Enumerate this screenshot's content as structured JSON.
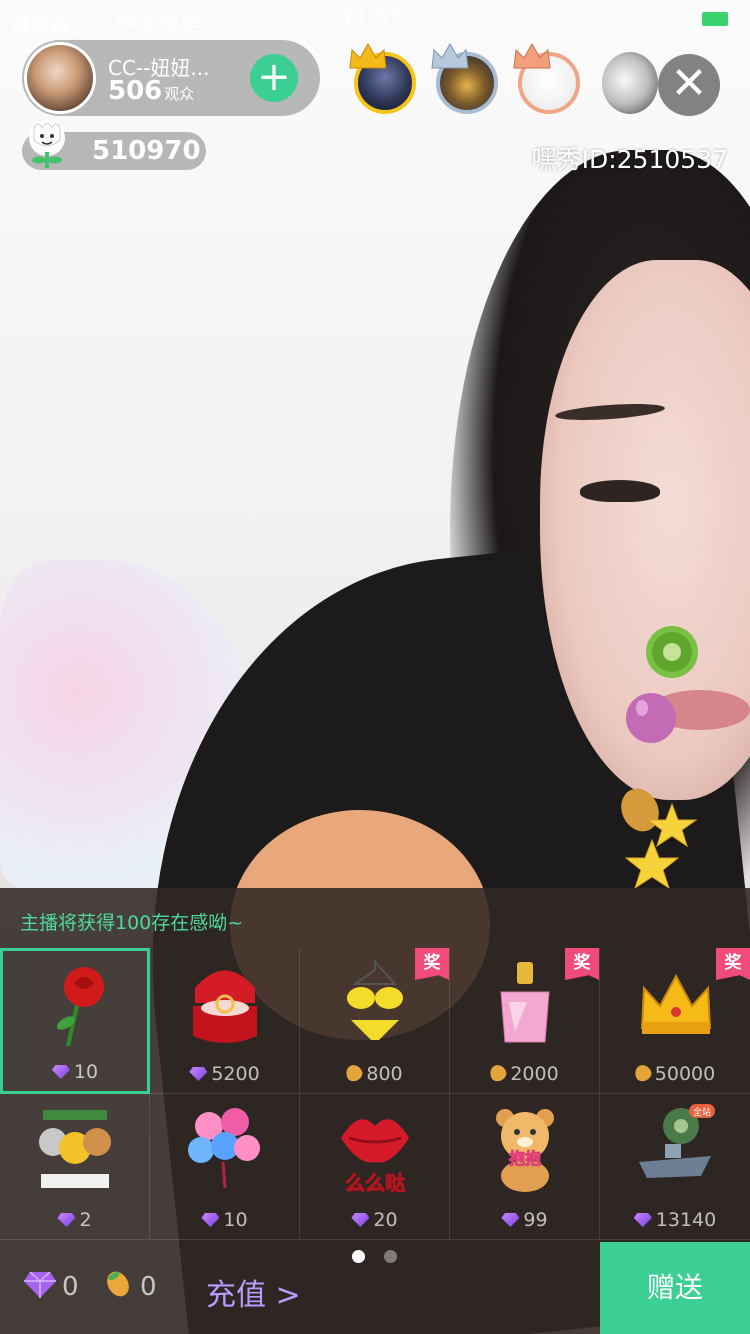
{
  "status_bar": {
    "carrier": "●●●○○ 中国电信 ⌔",
    "time": "11:53"
  },
  "host": {
    "name": "CC--妞妞...",
    "viewer_count": "506",
    "viewer_label": "观众"
  },
  "flower_score": "510970",
  "room_id": "嘿秀ID:2510537",
  "panel": {
    "hint": "主播将获得100存在感呦~",
    "award_tag": "奖",
    "gifts": [
      {
        "name": "rose",
        "price": "10",
        "currency": "diamond",
        "award": false,
        "selected": true
      },
      {
        "name": "ring-box",
        "price": "5200",
        "currency": "diamond",
        "award": false,
        "selected": false
      },
      {
        "name": "bikini",
        "price": "800",
        "currency": "bean",
        "award": true,
        "selected": false
      },
      {
        "name": "perfume",
        "price": "2000",
        "currency": "bean",
        "award": true,
        "selected": false
      },
      {
        "name": "crown",
        "price": "50000",
        "currency": "bean",
        "award": true,
        "selected": false
      },
      {
        "name": "medals",
        "price": "2",
        "currency": "diamond",
        "award": false,
        "selected": false
      },
      {
        "name": "heart-balloons",
        "price": "10",
        "currency": "diamond",
        "award": false,
        "selected": false
      },
      {
        "name": "kiss-lips",
        "price": "20",
        "currency": "diamond",
        "award": false,
        "selected": false
      },
      {
        "name": "hug-bear",
        "price": "99",
        "currency": "diamond",
        "award": false,
        "selected": false
      },
      {
        "name": "warship",
        "price": "13140",
        "currency": "diamond",
        "award": false,
        "selected": false
      }
    ],
    "kiss_text": "么么哒",
    "bear_text": "抱抱",
    "ship_tag": "全站",
    "pages": 2,
    "current_page": 1
  },
  "wallet": {
    "diamonds": "0",
    "beans": "0",
    "recharge_label": "充值 >"
  },
  "send_label": "赠送",
  "colors": {
    "accent": "#3ccf93",
    "recharge": "#b99cff",
    "award": "#f04b7a"
  }
}
